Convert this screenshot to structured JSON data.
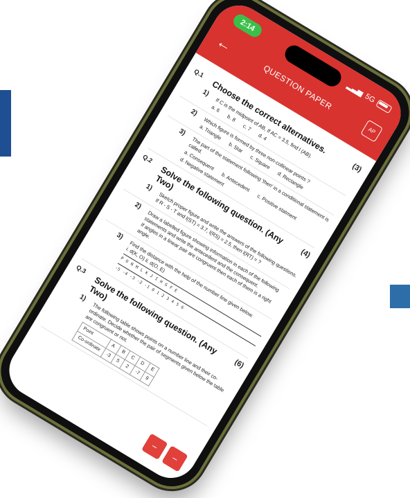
{
  "status": {
    "time": "2:14",
    "network": "5G"
  },
  "appbar": {
    "back_icon": "arrow-left-icon",
    "title": "QUESTION PAPER",
    "ap_badge": "AP"
  },
  "q1": {
    "number": "Q.1",
    "title": "Choose the correct alternatives.",
    "marks": "(3)",
    "items": [
      {
        "num": "1)",
        "text": "If C is the midpoint of AB, If AC = 3.5, find l (AB).",
        "options": [
          "a. 6",
          "b. 8",
          "c. 7",
          "d. 4"
        ]
      },
      {
        "num": "2)",
        "text": "Which figure is formed by three non-collinear points ?",
        "options": [
          "a. Triangle",
          "b. Star",
          "c. Square",
          "d. Rectangle"
        ]
      },
      {
        "num": "3)",
        "text": "The part of the statement following 'then' in a conditional statement is called.",
        "options": [
          "a. Consequent",
          "b. Antecedent",
          "c. Positive statment",
          "d. Negative statement"
        ]
      }
    ]
  },
  "q2": {
    "number": "Q.2",
    "title": "Solve the following question. (Any Two)",
    "marks": "(4)",
    "items": [
      {
        "num": "1)",
        "text": "Sketch proper figure and write the answers of the following questions.",
        "sub": "If R - S - T and l(ST) = 3.7, l(RS) = 2.5, then l(RT) = ?"
      },
      {
        "num": "2)",
        "text": "Draw a labelled figure showing information in each of the following statements and write the antecedent and the consequent.",
        "sub": "If angles in a linear pair are congruent then each of them is a right angle."
      },
      {
        "num": "3)",
        "text": "Find the distance with the help of the number line given below.",
        "sub": "i. d(K, O)    ii. d(O, E)"
      }
    ],
    "numline_a": "P  O  N  M  L  K  J  I  H  G  F  E",
    "numline_b": "-5 -4 -3 -2 -1  0  1  2  3  4  5  6"
  },
  "q3": {
    "number": "Q.3",
    "title": "Solve the following question. (Any Two)",
    "marks": "(6)",
    "items": [
      {
        "num": "1)",
        "text": "The following table shows points on a number line and their co-ordinate. Decide whether the pair of segments given below the table are congruent or not."
      }
    ],
    "table": {
      "header": [
        "Point",
        "A",
        "B",
        "C",
        "D",
        "E"
      ],
      "row_label": "Co-ordinate",
      "row": [
        "-3",
        "5",
        "2",
        "-7",
        "9"
      ]
    }
  },
  "float_buttons": [
    "minus-icon",
    "minus-icon"
  ]
}
